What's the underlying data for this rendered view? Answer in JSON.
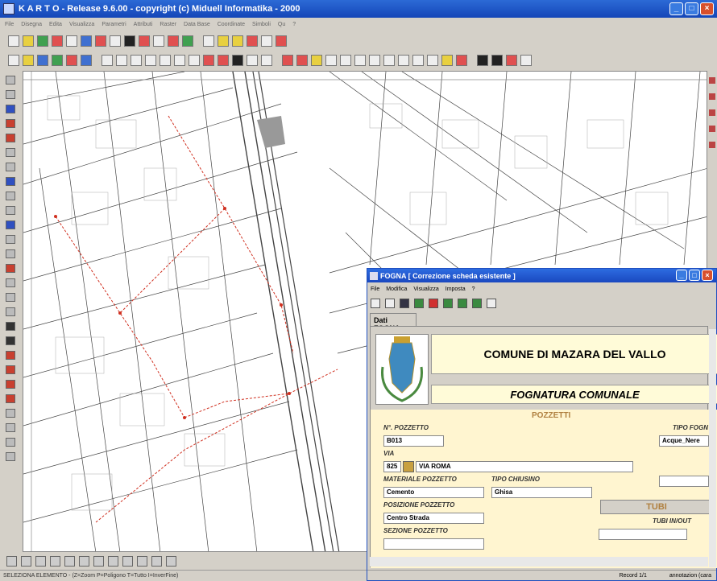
{
  "app": {
    "title": "K A R T O  - Release 9.6.00 - copyright (c) Miduell Informatika - 2000"
  },
  "menu": [
    "File",
    "Disegna",
    "Edita",
    "Visualizza",
    "Parametri",
    "Attributi",
    "Raster",
    "Data Base",
    "Coordinate",
    "Simboli",
    "Qu",
    "?"
  ],
  "status": {
    "text": "SELEZIONA ELEMENTO - (Z=Zoom P=Poligono T=Tutto I=InverFine)"
  },
  "dialog": {
    "title": "FOGNA [ Correzione scheda esistente ]",
    "menu": [
      "File",
      "Modifica",
      "Visualizza",
      "Imposta",
      "?"
    ],
    "tab": "Dati FOGNA",
    "comune": "COMUNE DI MAZARA DEL VALLO",
    "subtitle": "FOGNATURA COMUNALE",
    "section_pozzetti": "POZZETTI",
    "section_tubi": "TUBI",
    "fields": {
      "n_pozzetto_label": "N°. POZZETTO",
      "n_pozzetto": "B013",
      "tipo_fogna_label": "TIPO FOGN",
      "tipo_fogna": "Acque_Nere",
      "via_label": "VIA",
      "via_code": "825",
      "via_name": "VIA ROMA",
      "materiale_label": "MATERIALE POZZETTO",
      "materiale": "Cemento",
      "tipo_chiusino_label": "TIPO CHIUSINO",
      "tipo_chiusino": "Ghisa",
      "posizione_label": "POSIZIONE POZZETTO",
      "posizione": "Centro Strada",
      "sezione_label": "SEZIONE POZZETTO",
      "tubi_inout_label": "TUBI IN/OUT"
    },
    "status_record": "Record 1/1",
    "status_annot": "annotazion (cara"
  }
}
